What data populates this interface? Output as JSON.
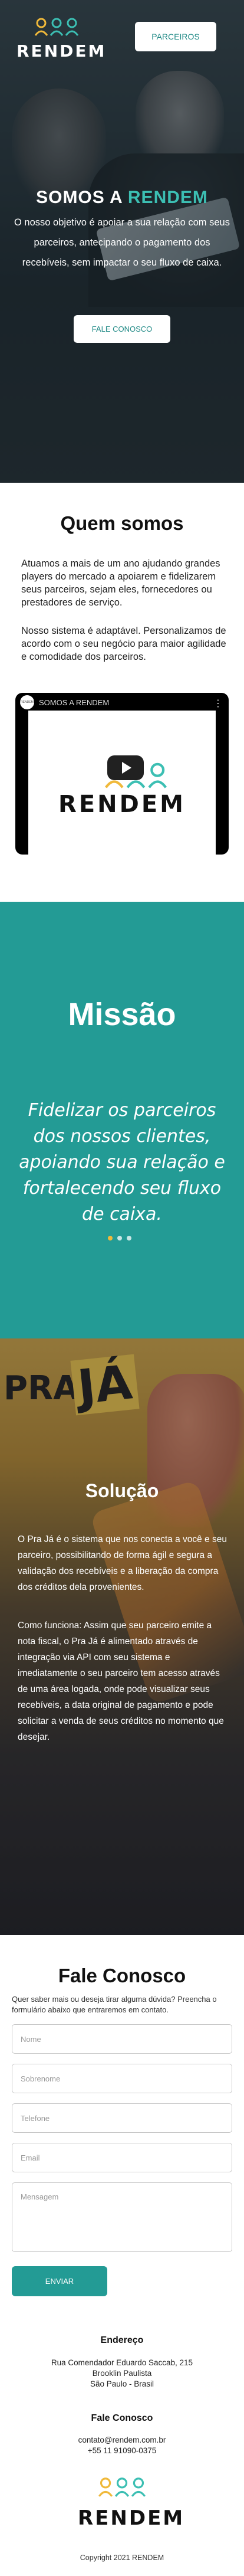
{
  "brand": {
    "name": "RENDEM",
    "colors": {
      "teal": "#239b95",
      "accent_green": "#3cbfb3",
      "yellow": "#f0b93a",
      "orange": "#f2a13c",
      "white": "#ffffff"
    }
  },
  "hero": {
    "nav_button": "PARCEIROS",
    "title_prefix": "SOMOS A ",
    "title_accent": "RENDEM",
    "text": "O nosso objetivo é apoiar a sua relação com seus parceiros, antecipando o pagamento dos recebíveis, sem impactar o seu fluxo de caixa.",
    "cta": "FALE CONOSCO"
  },
  "quem_somos": {
    "title": "Quem somos",
    "p1": "Atuamos a mais de um ano ajudando grandes players do mercado a apoiarem e fidelizarem seus parceiros, sejam eles, fornecedores ou prestadores de serviço.",
    "p2": "Nosso sistema é adaptável. Personalizamos de acordo com o seu negócio para maior agilidade e comodidade dos parceiros.",
    "video": {
      "title": "SOMOS A RENDEM",
      "channel_label": "RENDEM",
      "word": "RENDEM",
      "more_icon": "more-vert-icon",
      "play_icon": "play-icon"
    }
  },
  "missao": {
    "title": "Missão",
    "text": "Fidelizar os parceiros dos nossos clientes, apoiando sua relação e fortalecendo seu fluxo de caixa.",
    "slide_count": 3,
    "active_slide": 1
  },
  "solucao": {
    "logo_pra": "PRA",
    "logo_ja": "JÁ",
    "title": "Solução",
    "p1": "O Pra Já é o sistema que nos conecta a você e seu parceiro, possibilitando de forma ágil e segura a validação dos recebíveis e a liberação da compra dos créditos dela provenientes.",
    "p2": "Como funciona: Assim que seu parceiro emite a nota fiscal, o Pra Já é alimentado através de integração via API com seu sistema e imediatamente o seu parceiro tem acesso através de uma área logada, onde pode visualizar seus recebíveis, a data original de pagamento e pode solicitar a venda de seus créditos no momento que desejar."
  },
  "contato": {
    "title": "Fale Conosco",
    "subtitle": "Quer saber mais ou deseja tirar alguma dúvida? Preencha o formulário abaixo que entraremos em contato.",
    "fields": {
      "nome": "Nome",
      "sobrenome": "Sobrenome",
      "telefone": "Telefone",
      "email": "Email",
      "mensagem": "Mensagem"
    },
    "submit": "ENVIAR"
  },
  "footer": {
    "endereco_title": "Endereço",
    "endereco_lines": [
      "Rua Comendador Eduardo Saccab, 215",
      "Brooklin Paulista",
      "São Paulo - Brasil"
    ],
    "contato_title": "Fale Conosco",
    "email": "contato@rendem.com.br",
    "phone": "+55 11 91090-0375",
    "logo_word": "RENDEM",
    "copyright": "Copyright 2021 RENDEM"
  }
}
